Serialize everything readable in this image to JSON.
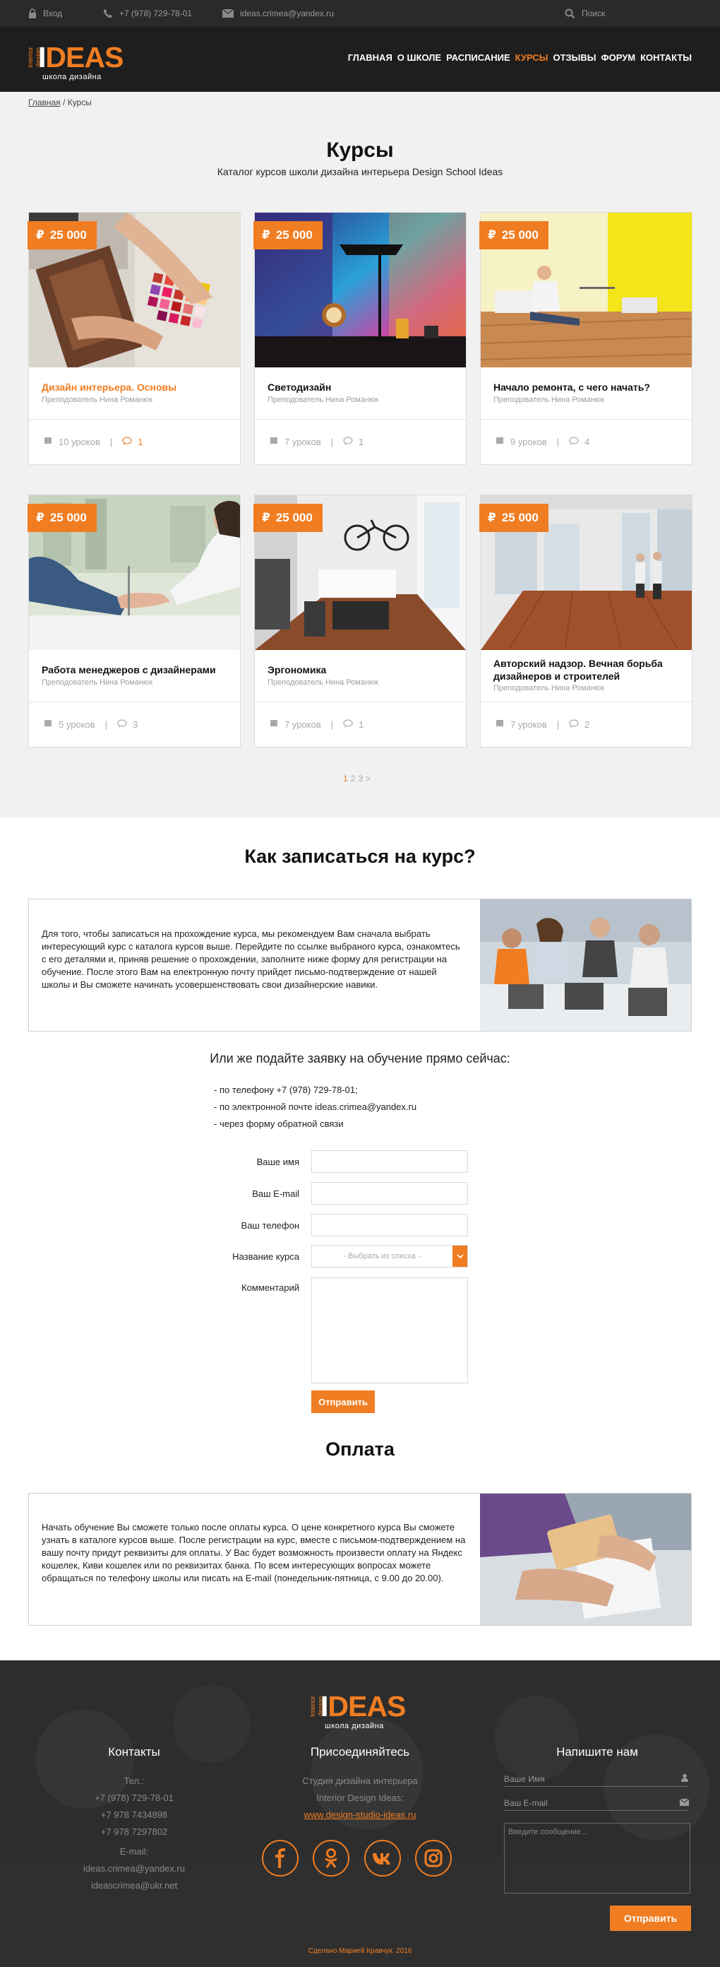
{
  "topbar": {
    "login": "Вход",
    "phone": "+7 (978) 729-78-01",
    "email": "ideas.crimea@yandex.ru",
    "search": "Поиск"
  },
  "logo": {
    "main_a": "I",
    "main_b": "DEAS",
    "side": "Interior design",
    "sub": "школа дизайна"
  },
  "nav": [
    "ГЛАВНАЯ",
    "О ШКОЛЕ",
    "РАСПИСАНИЕ",
    "КУРСЫ",
    "ОТЗЫВЫ",
    "ФОРУМ",
    "КОНТАКТЫ"
  ],
  "nav_active": "КУРСЫ",
  "breadcrumb": {
    "home": "Главная",
    "sep": " / ",
    "current": "Курсы"
  },
  "page": {
    "title": "Курсы",
    "subtitle": "Каталог курсов школи дизайна интерьера Design School Ideas"
  },
  "courses": [
    {
      "price": "25 000",
      "title": "Дизайн интерьера. Основы",
      "teacher": "Преподователь Нина Романюк",
      "lessons": "10 уроков",
      "comments": "1",
      "highlight": true
    },
    {
      "price": "25 000",
      "title": "Светодизайн",
      "teacher": "Преподователь Нина Романюк",
      "lessons": "7 уроков",
      "comments": "1",
      "highlight": false
    },
    {
      "price": "25 000",
      "title": "Начало ремонта, с чего начать?",
      "teacher": "Преподователь Нина Романюк",
      "lessons": "9 уроков",
      "comments": "4",
      "highlight": false
    },
    {
      "price": "25 000",
      "title": "Работа менеджеров с дизайнерами",
      "teacher": "Преподователь Нина Романюк",
      "lessons": "5 уроков",
      "comments": "3",
      "highlight": false
    },
    {
      "price": "25 000",
      "title": "Эргономика",
      "teacher": "Преподователь Нина Романюк",
      "lessons": "7 уроков",
      "comments": "1",
      "highlight": false
    },
    {
      "price": "25 000",
      "title": "Авторский надзор. Вечная борьба дизайнеров и строителей",
      "teacher": "Преподователь Нина Романюк",
      "lessons": "7 уроков",
      "comments": "2",
      "highlight": false
    }
  ],
  "pagination": {
    "current": "1",
    "pages": [
      "2",
      "3"
    ],
    "next": ">"
  },
  "howto": {
    "title": "Как записаться на курс?",
    "text": "Для того, чтобы записаться на прохождение курса, мы рекомендуем Вам сначала выбрать интересующий курс с каталога курсов выше. Перейдите по ссылке выбраного курса, ознакомтесь с его деталями и, приняв решение о прохождении, заполните ниже форму для регистрации на обучение. После этого Вам на електронную почту прийдет письмо-подтверждение от нашей школы и Вы сможете начинать усовершенствовать свои дизайнерские навики.",
    "or_title": "Или же подайте заявку на обучение прямо сейчас:",
    "ways": [
      "- по телефону +7 (978) 729-78-01;",
      "- по электронной почте ideas.crimea@yandex.ru",
      "- через форму обратной связи"
    ]
  },
  "form": {
    "name_label": "Ваше имя",
    "email_label": "Ваш E-mail",
    "phone_label": "Ваш телефон",
    "course_label": "Название курса",
    "course_placeholder": "- Выбрать из списка -",
    "comment_label": "Комментарий",
    "submit": "Отправить"
  },
  "payment": {
    "title": "Оплата",
    "text": "Начать обучение Вы сможете только после оплаты курса. О цене конкретного курса Вы сможете узнать в каталоге курсов выше. После регистрации на курс, вместе с письмом-подтверждением на вашу почту придут реквизиты для оплаты. У Вас будет возможность произвести оплату на Яндекс кошелек, Киви кошелек или по реквизитах банка. По всем интересующих вопросах можете обращаться по телефону школы или писать на E-mail (понедельник-пятница, с 9.00 до 20.00)."
  },
  "footer": {
    "contacts_title": "Контакты",
    "tel_label": "Тел.:",
    "phones": [
      "+7 (978) 729-78-01",
      "+7 978 7434898",
      "+7 978 7297802"
    ],
    "email_label": "E-mail:",
    "emails": [
      "ideas.crimea@yandex.ru",
      "ideascrimea@ukr.net"
    ],
    "join_title": "Присоединяйтесь",
    "join_lines": [
      "Студия дизайна интерьера",
      "Interior Design Ideas:"
    ],
    "join_link": "www.design-studio-ideas.ru",
    "social": [
      "facebook",
      "odnoklassniki",
      "vk",
      "instagram"
    ],
    "write_title": "Напишите нам",
    "name_placeholder": "Ваше Имя",
    "email_placeholder": "Ваш E-mail",
    "message_placeholder": "Введите сообщение...",
    "send": "Отправить",
    "credit": "Сделано Марией Кравчук. 2016"
  },
  "colors": {
    "accent": "#f07d22",
    "dark": "#1e1e1e",
    "topbar": "#2a2a2a",
    "bg": "#f1f1f1"
  }
}
